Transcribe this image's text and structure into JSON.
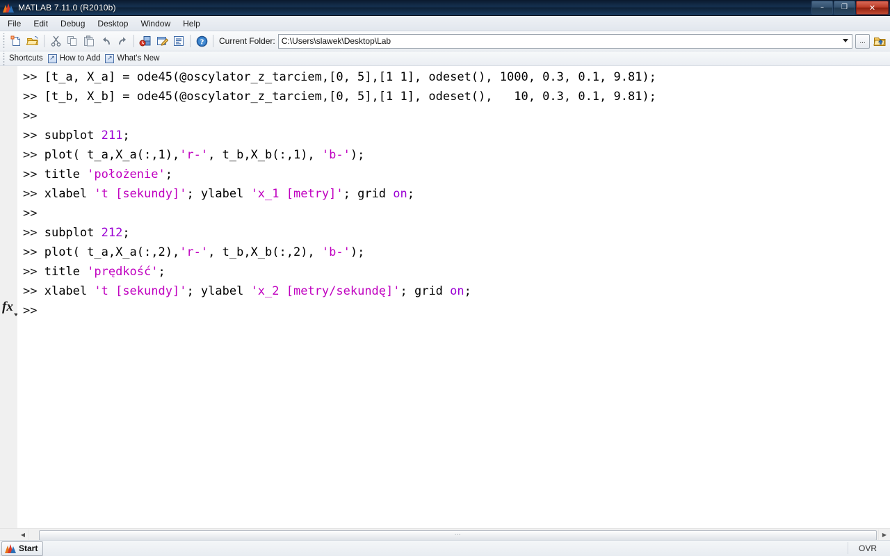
{
  "window": {
    "title": "MATLAB  7.11.0 (R2010b)",
    "app_icon": "matlab-membrane-icon",
    "minimize_label": "–",
    "restore_label": "❐",
    "close_label": "✕"
  },
  "menu": {
    "items": [
      {
        "label": "File"
      },
      {
        "label": "Edit"
      },
      {
        "label": "Debug"
      },
      {
        "label": "Desktop"
      },
      {
        "label": "Window"
      },
      {
        "label": "Help"
      }
    ]
  },
  "toolbar": {
    "buttons": [
      {
        "name": "new-script-icon",
        "tip": "New Script"
      },
      {
        "name": "open-file-icon",
        "tip": "Open File"
      },
      {
        "name": "cut-icon",
        "tip": "Cut"
      },
      {
        "name": "copy-icon",
        "tip": "Copy"
      },
      {
        "name": "paste-icon",
        "tip": "Paste"
      },
      {
        "name": "undo-icon",
        "tip": "Undo"
      },
      {
        "name": "redo-icon",
        "tip": "Redo"
      },
      {
        "name": "simulink-icon",
        "tip": "Simulink Library"
      },
      {
        "name": "guide-icon",
        "tip": "GUIDE"
      },
      {
        "name": "profiler-icon",
        "tip": "Profiler"
      },
      {
        "name": "help-icon",
        "tip": "Help"
      }
    ],
    "current_folder_label": "Current Folder:",
    "current_folder_value": "C:\\Users\\slawek\\Desktop\\Lab",
    "browse_label": "...",
    "up_folder_icon": "folder-up-icon"
  },
  "shortcuts_bar": {
    "items": [
      {
        "label": "Shortcuts",
        "arrow": false
      },
      {
        "label": "How to Add",
        "arrow": true
      },
      {
        "label": "What's New",
        "arrow": true
      }
    ],
    "arrow_glyph": "↗"
  },
  "command_window": {
    "prompt": ">> ",
    "fx_label": "fx",
    "lines": [
      {
        "prompt": ">> ",
        "parts": [
          {
            "t": "[t_a, X_a] = ode45(@oscylator_z_tarciem,[0, 5],[1 1], odeset(), 1000, 0.3, 0.1, 9.81);",
            "c": "plain"
          }
        ]
      },
      {
        "prompt": ">> ",
        "parts": [
          {
            "t": "[t_b, X_b] = ode45(@oscylator_z_tarciem,[0, 5],[1 1], odeset(),   10, 0.3, 0.1, 9.81);",
            "c": "plain"
          }
        ]
      },
      {
        "prompt": ">> ",
        "parts": []
      },
      {
        "prompt": ">> ",
        "parts": [
          {
            "t": "subplot ",
            "c": "plain"
          },
          {
            "t": "211",
            "c": "kw"
          },
          {
            "t": ";",
            "c": "plain"
          }
        ]
      },
      {
        "prompt": ">> ",
        "parts": [
          {
            "t": "plot( t_a,X_a(:,1),",
            "c": "plain"
          },
          {
            "t": "'r-'",
            "c": "str"
          },
          {
            "t": ", t_b,X_b(:,1), ",
            "c": "plain"
          },
          {
            "t": "'b-'",
            "c": "str"
          },
          {
            "t": ");",
            "c": "plain"
          }
        ]
      },
      {
        "prompt": ">> ",
        "parts": [
          {
            "t": "title ",
            "c": "plain"
          },
          {
            "t": "'położenie'",
            "c": "str"
          },
          {
            "t": ";",
            "c": "plain"
          }
        ]
      },
      {
        "prompt": ">> ",
        "parts": [
          {
            "t": "xlabel ",
            "c": "plain"
          },
          {
            "t": "'t [sekundy]'",
            "c": "str"
          },
          {
            "t": "; ylabel ",
            "c": "plain"
          },
          {
            "t": "'x_1 [metry]'",
            "c": "str"
          },
          {
            "t": "; grid ",
            "c": "plain"
          },
          {
            "t": "on",
            "c": "kw"
          },
          {
            "t": ";",
            "c": "plain"
          }
        ]
      },
      {
        "prompt": ">> ",
        "parts": []
      },
      {
        "prompt": ">> ",
        "parts": [
          {
            "t": "subplot ",
            "c": "plain"
          },
          {
            "t": "212",
            "c": "kw"
          },
          {
            "t": ";",
            "c": "plain"
          }
        ]
      },
      {
        "prompt": ">> ",
        "parts": [
          {
            "t": "plot( t_a,X_a(:,2),",
            "c": "plain"
          },
          {
            "t": "'r-'",
            "c": "str"
          },
          {
            "t": ", t_b,X_b(:,2), ",
            "c": "plain"
          },
          {
            "t": "'b-'",
            "c": "str"
          },
          {
            "t": ");",
            "c": "plain"
          }
        ]
      },
      {
        "prompt": ">> ",
        "parts": [
          {
            "t": "title ",
            "c": "plain"
          },
          {
            "t": "'prędkość'",
            "c": "str"
          },
          {
            "t": ";",
            "c": "plain"
          }
        ]
      },
      {
        "prompt": ">> ",
        "parts": [
          {
            "t": "xlabel ",
            "c": "plain"
          },
          {
            "t": "'t [sekundy]'",
            "c": "str"
          },
          {
            "t": "; ylabel ",
            "c": "plain"
          },
          {
            "t": "'x_2 [metry/sekundę]'",
            "c": "str"
          },
          {
            "t": "; grid ",
            "c": "plain"
          },
          {
            "t": "on",
            "c": "kw"
          },
          {
            "t": ";",
            "c": "plain"
          }
        ]
      },
      {
        "prompt": ">> ",
        "parts": [],
        "is_active": true
      }
    ]
  },
  "hscrollbar": {
    "left_arrow": "◀",
    "right_arrow": "▶",
    "thumb_grip": "⋯"
  },
  "statusbar": {
    "start_label": "Start",
    "overwrite_label": "OVR"
  },
  "colors": {
    "string": "#c000c0",
    "keyword": "#9b00d3",
    "text": "#000000",
    "command_bg": "#ffffff",
    "chrome_bg": "#f0f0f0"
  }
}
